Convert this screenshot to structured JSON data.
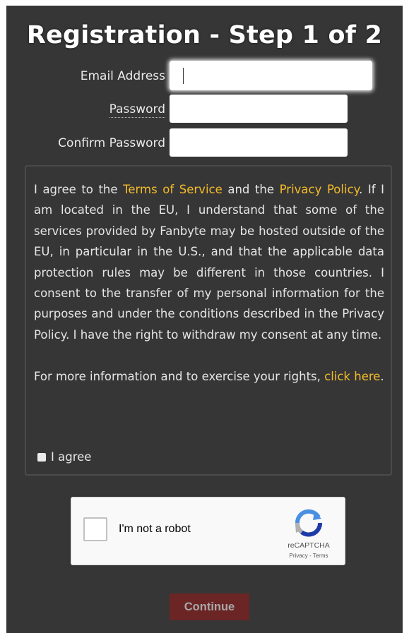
{
  "header": {
    "title": "Registration - Step 1 of 2"
  },
  "form": {
    "email_label": "Email Address",
    "password_label": "Password",
    "confirm_label": "Confirm Password",
    "email_value": "",
    "password_value": "",
    "confirm_value": ""
  },
  "consent": {
    "text_1": "I agree to the ",
    "terms_link": "Terms of Service",
    "text_2": " and the ",
    "privacy_link": "Privacy Policy",
    "text_3": ". If I am located in the EU, I understand that some of the services provided by Fanbyte may be hosted outside of the EU, in particular in the U.S., and that the applicable data protection rules may be different in those countries. I consent to the transfer of my personal information for the purposes and under the conditions described in the Privacy Policy. I have the right to withdraw my consent at any time.",
    "text_4": "For more information and to exercise your rights, ",
    "click_link": "click here",
    "text_5": ".",
    "agree_label": "I agree",
    "agree_checked": false
  },
  "captcha": {
    "label": "I'm not a robot",
    "brand": "reCAPTCHA",
    "terms": "Privacy - Terms",
    "logo_icon": "recaptcha-logo-icon"
  },
  "actions": {
    "continue_label": "Continue"
  },
  "colors": {
    "panel_bg": "#363636",
    "link": "#f4bb2a",
    "button_bg": "#6b2525",
    "button_text": "#a8a8a8"
  }
}
